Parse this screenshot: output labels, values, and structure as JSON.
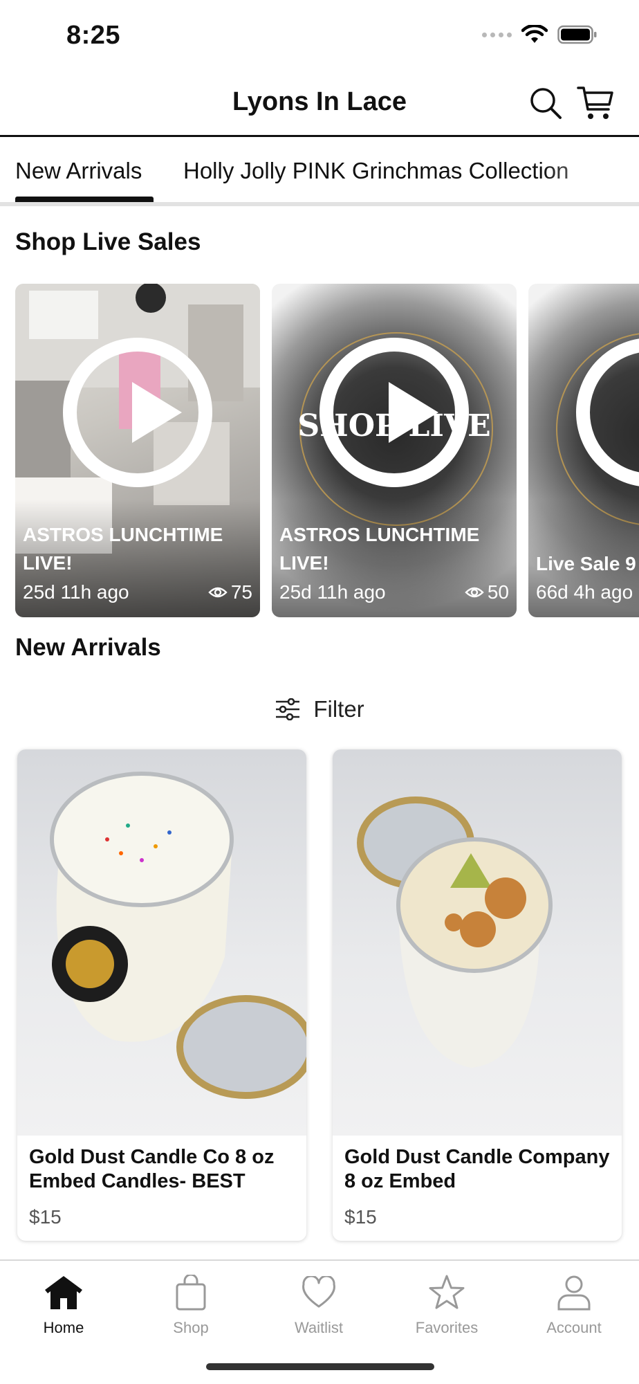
{
  "status_bar": {
    "time": "8:25"
  },
  "header": {
    "title": "Lyons In Lace",
    "search_icon": "search-icon",
    "cart_icon": "cart-icon"
  },
  "tabs": [
    {
      "label": "New Arrivals",
      "active": true
    },
    {
      "label": "Holly Jolly PINK Grinchmas Collection",
      "active": false
    }
  ],
  "live_section": {
    "title": "Shop Live Sales",
    "cards": [
      {
        "title": "ASTROS LUNCHTIME LIVE!",
        "time": "25d 11h ago",
        "views": "75"
      },
      {
        "title": "ASTROS LUNCHTIME LIVE!",
        "time": "25d 11h ago",
        "views": "50",
        "overlay_text": "SHOP LIVE"
      },
      {
        "title": "Live Sale 9",
        "time": "66d 4h ago",
        "views": ""
      }
    ]
  },
  "new_arrivals": {
    "title": "New Arrivals",
    "filter_label": "Filter",
    "products": [
      {
        "name": "Gold Dust Candle Co 8 oz Embed Candles- BEST",
        "price": "$15"
      },
      {
        "name": "Gold Dust Candle Company 8 oz Embed",
        "price": "$15"
      }
    ]
  },
  "bottom_nav": [
    {
      "label": "Home",
      "icon": "home-icon",
      "active": true
    },
    {
      "label": "Shop",
      "icon": "shopping-bag-icon",
      "active": false
    },
    {
      "label": "Waitlist",
      "icon": "heart-icon",
      "active": false
    },
    {
      "label": "Favorites",
      "icon": "star-icon",
      "active": false
    },
    {
      "label": "Account",
      "icon": "user-icon",
      "active": false
    }
  ]
}
